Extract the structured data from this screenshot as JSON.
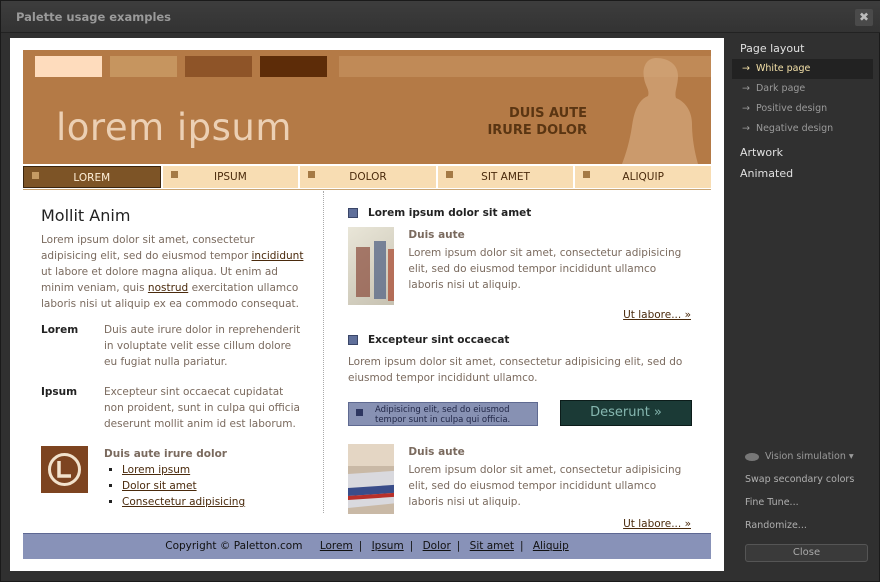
{
  "window": {
    "title": "Palette usage examples",
    "close_glyph": "✖"
  },
  "header": {
    "logo": "lorem ipsum",
    "tagline_line1": "DUIS AUTE",
    "tagline_line2": "IRURE DOLOR",
    "swatch_colors": [
      "#fedcbd",
      "#c6955f",
      "#8e5428",
      "#5d2c08"
    ]
  },
  "nav": {
    "items": [
      "LOREM",
      "IPSUM",
      "DOLOR",
      "SIT AMET",
      "ALIQUIP"
    ],
    "active_index": 0
  },
  "left": {
    "heading": "Mollit Anim",
    "para_1": "Lorem ipsum dolor sit amet, consectetur adipisicing elit, sed do eiusmod tempor ",
    "link_1": "incididunt",
    "para_2": " ut labore et dolore magna aliqua. Ut enim ad minim veniam, quis ",
    "link_2": "nostrud",
    "para_3": " exercitation ullamco laboris nisi ut aliquip ex ea commodo consequat.",
    "defs": [
      {
        "term": "Lorem",
        "desc": "Duis aute irure dolor in reprehenderit in voluptate velit esse cillum dolore eu fugiat nulla pariatur."
      },
      {
        "term": "Ipsum",
        "desc": "Excepteur sint occaecat cupidatat non proident, sunt in culpa qui officia deserunt mollit anim id est laborum."
      }
    ],
    "icon_heading": "Duis aute irure dolor",
    "icon_links": [
      "Lorem ipsum",
      "Dolor sit amet",
      "Consectetur adipisicing"
    ]
  },
  "right": {
    "section_1_heading": "Lorem ipsum dolor sit amet",
    "media_1_sub": "Duis aute",
    "media_1_text": "Lorem ipsum dolor sit amet, consectetur adipisicing elit, sed do eiusmod tempor incididunt ullamco laboris nisi ut aliquip.",
    "more_1": "Ut labore... »",
    "section_2_heading": "Excepteur sint occaecat",
    "section_2_text": "Lorem ipsum dolor sit amet, consectetur adipisicing elit, sed do eiusmod tempor incididunt ullamco.",
    "info_box": "Adipisicing elit, sed do eiusmod tempor sunt in culpa qui officia.",
    "cta": "Deserunt »",
    "media_2_sub": "Duis aute",
    "media_2_text": "Lorem ipsum dolor sit amet, consectetur adipisicing elit, sed do eiusmod tempor incididunt ullamco laboris nisi ut aliquip.",
    "more_2": "Ut labore... »"
  },
  "footer": {
    "copyright": "Copyright © Paletton.com",
    "links": [
      "Lorem",
      "Ipsum",
      "Dolor",
      "Sit amet",
      "Aliquip"
    ]
  },
  "sidebar": {
    "page_layout_label": "Page layout",
    "layouts": [
      "White page",
      "Dark page",
      "Positive design",
      "Negative design"
    ],
    "selected_layout_index": 0,
    "artwork_label": "Artwork",
    "animated_label": "Animated",
    "vision_label": "Vision simulation",
    "swap_label": "Swap secondary colors",
    "fine_tune_label": "Fine Tune...",
    "randomize_label": "Randomize...",
    "close_label": "Close"
  }
}
